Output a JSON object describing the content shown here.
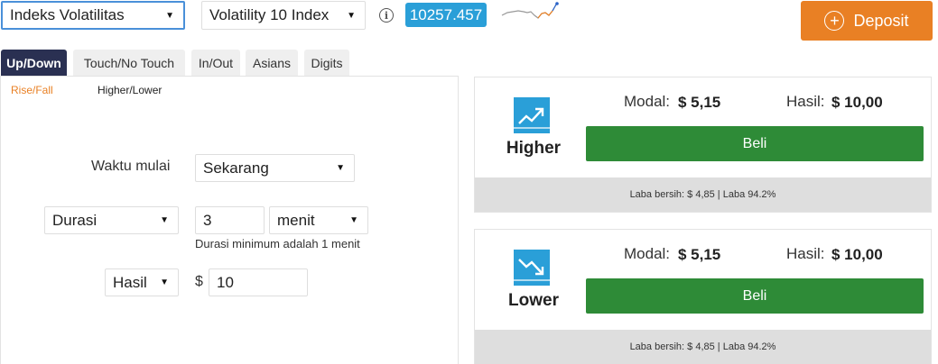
{
  "header": {
    "market_select": "Indeks Volatilitas",
    "underlying_select": "Volatility 10 Index",
    "info_icon": "info-icon",
    "spot_price": "10257.457",
    "deposit_label": "Deposit",
    "deposit_icon": "plus-circle-icon"
  },
  "tabs": [
    "Up/Down",
    "Touch/No Touch",
    "In/Out",
    "Asians",
    "Digits"
  ],
  "active_tab": "Up/Down",
  "subtabs": [
    "Rise/Fall",
    "Higher/Lower"
  ],
  "form": {
    "start_label": "Waktu mulai",
    "start_value": "Sekarang",
    "duration_type": "Durasi",
    "duration_amount": "3",
    "duration_unit": "menit",
    "duration_hint": "Durasi minimum adalah 1 menit",
    "payout_type": "Hasil",
    "currency": "$",
    "amount": "10"
  },
  "contracts": [
    {
      "title": "Higher",
      "icon": "trend-up-icon",
      "stake_label": "Modal:",
      "stake_value": "$ 5,15",
      "payout_label": "Hasil:",
      "payout_value": "$ 10,00",
      "buy_label": "Beli",
      "footer": "Laba bersih: $ 4,85 | Laba 94.2%"
    },
    {
      "title": "Lower",
      "icon": "trend-down-icon",
      "stake_label": "Modal:",
      "stake_value": "$ 5,15",
      "payout_label": "Hasil:",
      "payout_value": "$ 10,00",
      "buy_label": "Beli",
      "footer": "Laba bersih: $ 4,85 | Laba 94.2%"
    }
  ],
  "colors": {
    "accent_orange": "#e98024",
    "price_blue": "#2a9fd8",
    "buy_green": "#2e8b37",
    "active_tab_navy": "#2a3052"
  }
}
